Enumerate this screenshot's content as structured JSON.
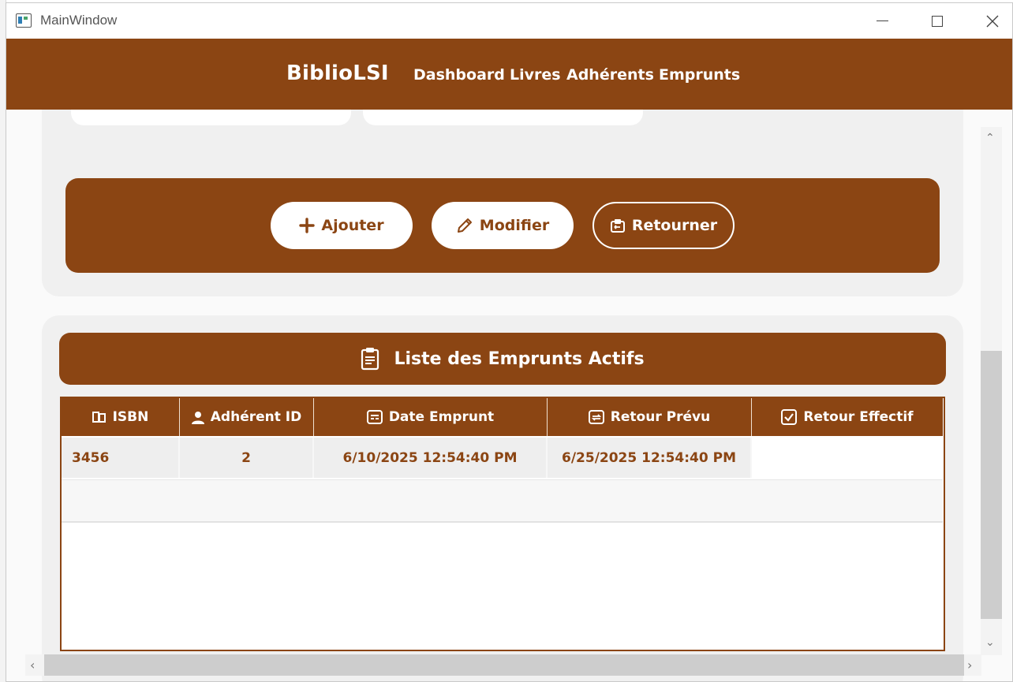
{
  "window": {
    "title": "MainWindow"
  },
  "navbar": {
    "brand": "BiblioLSI",
    "items": [
      {
        "label": "Dashboard"
      },
      {
        "label": "Livres"
      },
      {
        "label": "Adhérents"
      },
      {
        "label": "Emprunts"
      }
    ]
  },
  "actions": {
    "add_label": "Ajouter",
    "edit_label": "Modifier",
    "return_label": "Retourner"
  },
  "list": {
    "title": "Liste des Emprunts Actifs",
    "columns": [
      "ISBN",
      "Adhérent ID",
      "Date Emprunt",
      "Retour Prévu",
      "Retour Effectif"
    ],
    "rows": [
      {
        "isbn": "3456",
        "adherent_id": "2",
        "date_emprunt": "6/10/2025 12:54:40 PM",
        "retour_prevu": "6/25/2025 12:54:40 PM",
        "retour_effectif": ""
      }
    ]
  },
  "colors": {
    "primary": "#8b4513",
    "panel": "#f0f0f0",
    "white": "#ffffff"
  },
  "icons": {
    "add": "plus-icon",
    "edit": "pencil-icon",
    "return": "return-box-icon",
    "list": "clipboard-icon",
    "isbn": "books-icon",
    "adherent": "user-icon",
    "date": "calendar-icon",
    "planned": "refresh-calendar-icon",
    "effective": "checkbox-icon"
  }
}
